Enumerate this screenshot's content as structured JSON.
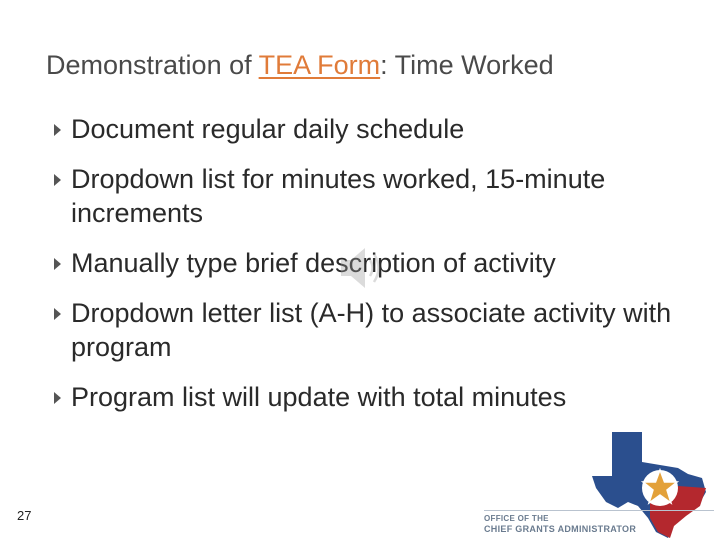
{
  "title": {
    "prefix": "Demonstration of ",
    "link_text": "TEA Form",
    "suffix": ": Time Worked"
  },
  "bullets": [
    {
      "text": "Document regular daily schedule"
    },
    {
      "text": "Dropdown list for minutes worked, 15-minute increments"
    },
    {
      "text": "Manually type brief description of activity"
    },
    {
      "text": "Dropdown letter list (A-H) to associate activity with program"
    },
    {
      "text": "Program list will update with total minutes"
    }
  ],
  "slide_number": "27",
  "logo": {
    "line1": "OFFICE OF THE",
    "line2": "CHIEF GRANTS ADMINISTRATOR"
  },
  "colors": {
    "link": "#e07b39",
    "text": "#2a2a2a",
    "texas_blue": "#2b4f8e",
    "texas_red": "#b4282e"
  },
  "icons": {
    "bullet_marker": "triangle-right-icon",
    "audio": "speaker-icon",
    "logo_map": "texas-map-icon"
  }
}
